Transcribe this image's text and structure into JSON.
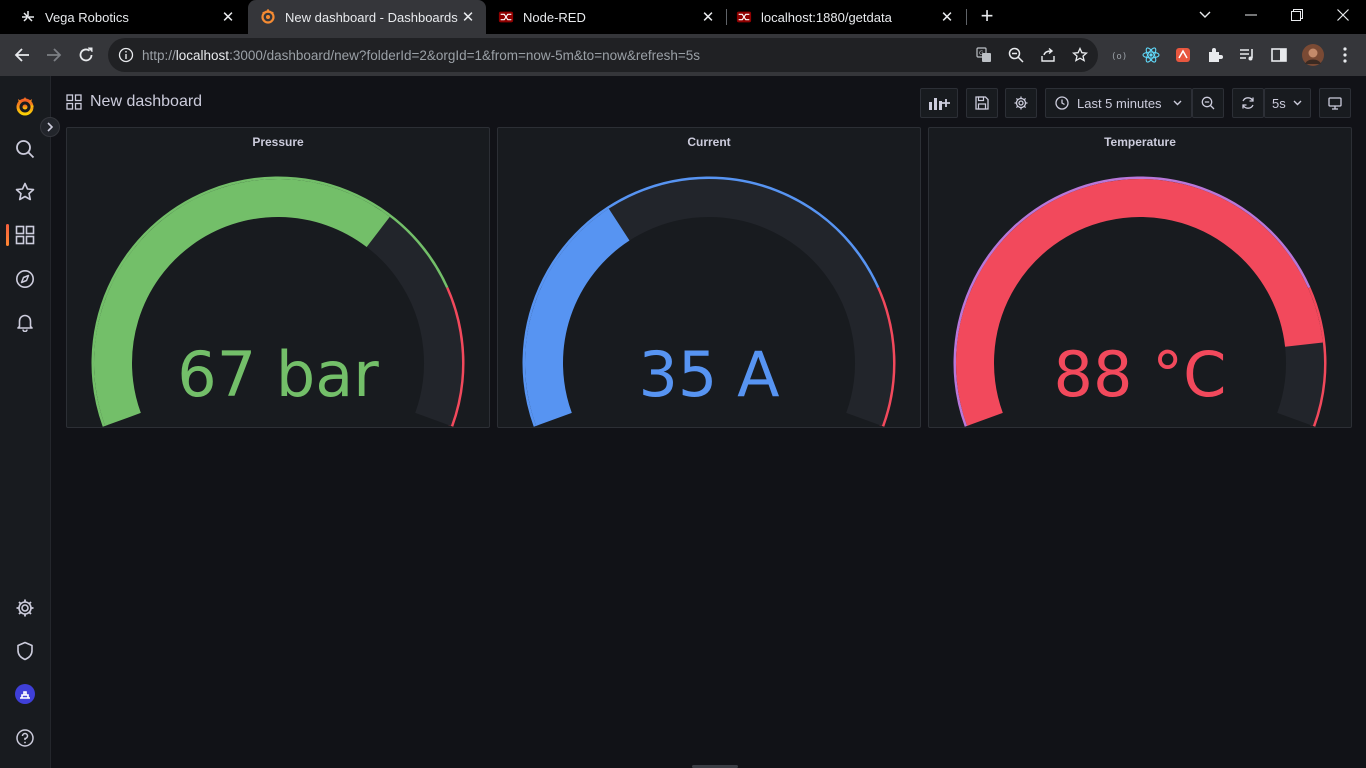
{
  "browser": {
    "tabs": [
      {
        "title": "Vega Robotics",
        "icon": "vega-icon",
        "active": false
      },
      {
        "title": "New dashboard - Dashboards - G",
        "icon": "grafana-icon",
        "active": true
      },
      {
        "title": "Node-RED",
        "icon": "node-red-icon",
        "active": false
      },
      {
        "title": "localhost:1880/getdata",
        "icon": "node-red-icon",
        "active": false
      }
    ],
    "url_prefix": "http://",
    "url_host": "localhost",
    "url_rest": ":3000/dashboard/new?folderId=2&orgId=1&from=now-5m&to=now&refresh=5s"
  },
  "dashboard": {
    "title": "New dashboard",
    "time_range_label": "Last 5 minutes",
    "refresh_label": "5s"
  },
  "panels": [
    {
      "title": "Pressure",
      "value_text": "67 bar",
      "value": 67,
      "min": 0,
      "max": 100,
      "color": "#73bf69",
      "thresholds": [
        {
          "from": 0,
          "to": 80,
          "color": "#73bf69"
        },
        {
          "from": 80,
          "to": 100,
          "color": "#f2495c"
        }
      ]
    },
    {
      "title": "Current",
      "value_text": "35 A",
      "value": 35,
      "min": 0,
      "max": 100,
      "color": "#5794f2",
      "thresholds": [
        {
          "from": 0,
          "to": 80,
          "color": "#5794f2"
        },
        {
          "from": 80,
          "to": 100,
          "color": "#f2495c"
        }
      ]
    },
    {
      "title": "Temperature",
      "value_text": "88 °C",
      "value": 88,
      "min": 0,
      "max": 100,
      "color": "#f2495c",
      "thresholds": [
        {
          "from": 0,
          "to": 80,
          "color": "#b877d9"
        },
        {
          "from": 80,
          "to": 100,
          "color": "#f2495c"
        }
      ]
    }
  ],
  "colors": {
    "background": "#111217",
    "panel": "#181b1f",
    "gauge_track": "#22252b",
    "accent": "#f55f3e"
  }
}
